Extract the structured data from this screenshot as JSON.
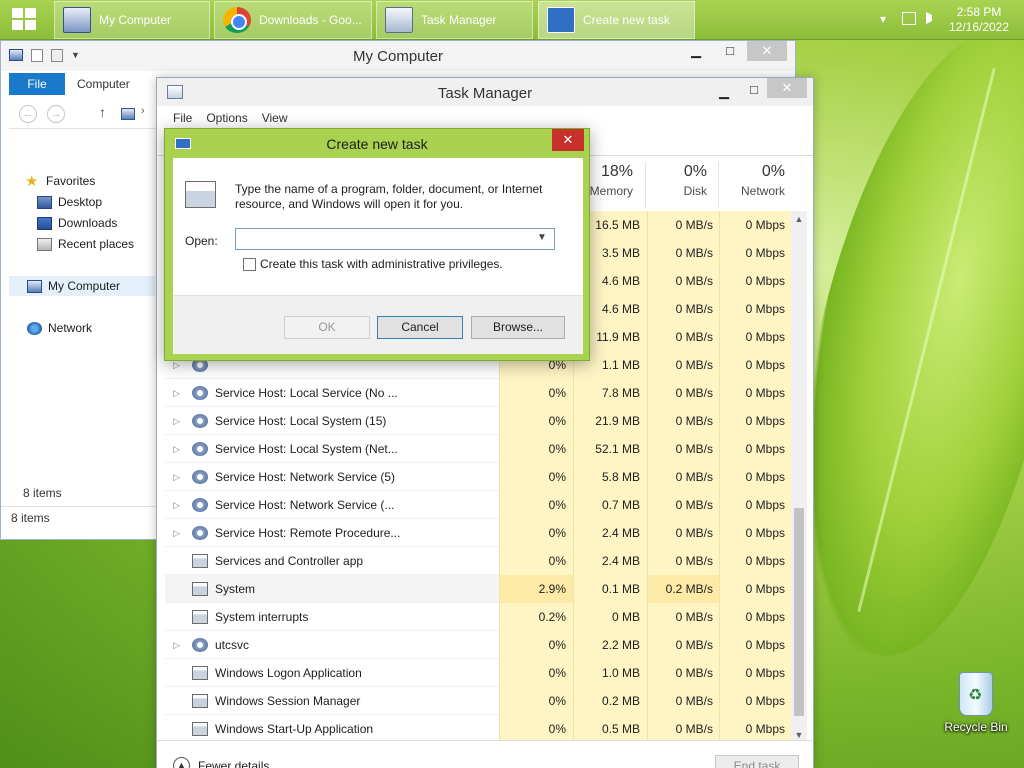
{
  "taskbar": {
    "items": [
      {
        "label": "My Computer",
        "icon": "computer-icon",
        "active": false
      },
      {
        "label": "Downloads - Goo...",
        "icon": "chrome-icon",
        "active": false
      },
      {
        "label": "Task Manager",
        "icon": "task-manager-icon",
        "active": false
      },
      {
        "label": "Create new task",
        "icon": "run-dialog-icon",
        "active": true
      }
    ],
    "tray": {
      "chevron": "▾",
      "network": "network-icon",
      "volume": "volume-icon"
    },
    "clock": {
      "time": "2:58 PM",
      "date": "12/16/2022"
    }
  },
  "my_computer": {
    "title": "My Computer",
    "ribbon": {
      "file_tab": "File",
      "computer_tab": "Computer"
    },
    "nav": [
      {
        "label": "Favorites",
        "icon": "star-icon"
      },
      {
        "label": "Desktop",
        "icon": "desktop-icon"
      },
      {
        "label": "Downloads",
        "icon": "downloads-icon"
      },
      {
        "label": "Recent places",
        "icon": "recent-places-icon"
      },
      {
        "label": "My Computer",
        "icon": "computer-icon"
      },
      {
        "label": "Network",
        "icon": "network-icon"
      }
    ],
    "items_count_inner": "8 items",
    "items_count": "8 items"
  },
  "task_manager": {
    "title": "Task Manager",
    "menu": [
      "File",
      "Options",
      "View"
    ],
    "columns": {
      "cpu": {
        "pct": "",
        "label": ""
      },
      "memory": {
        "pct": "18%",
        "label": "Memory"
      },
      "disk": {
        "pct": "0%",
        "label": "Disk"
      },
      "network": {
        "pct": "0%",
        "label": "Network"
      }
    },
    "rows": [
      {
        "name": "",
        "cpu": "",
        "mem": "16.5 MB",
        "disk": "0 MB/s",
        "net": "0 Mbps",
        "expand": false,
        "icon": "gear"
      },
      {
        "name": "",
        "cpu": "",
        "mem": "3.5 MB",
        "disk": "0 MB/s",
        "net": "0 Mbps",
        "expand": false,
        "icon": "gear"
      },
      {
        "name": "",
        "cpu": "",
        "mem": "4.6 MB",
        "disk": "0 MB/s",
        "net": "0 Mbps",
        "expand": false,
        "icon": "gear"
      },
      {
        "name": "",
        "cpu": "",
        "mem": "4.6 MB",
        "disk": "0 MB/s",
        "net": "0 Mbps",
        "expand": false,
        "icon": "gear"
      },
      {
        "name": "",
        "cpu": "",
        "mem": "11.9 MB",
        "disk": "0 MB/s",
        "net": "0 Mbps",
        "expand": false,
        "icon": "gear"
      },
      {
        "name": "",
        "cpu": "0%",
        "mem": "1.1 MB",
        "disk": "0 MB/s",
        "net": "0 Mbps",
        "expand": true,
        "icon": "gear"
      },
      {
        "name": "Service Host: Local Service (No ...",
        "cpu": "0%",
        "mem": "7.8 MB",
        "disk": "0 MB/s",
        "net": "0 Mbps",
        "expand": true,
        "icon": "gear"
      },
      {
        "name": "Service Host: Local System (15)",
        "cpu": "0%",
        "mem": "21.9 MB",
        "disk": "0 MB/s",
        "net": "0 Mbps",
        "expand": true,
        "icon": "gear"
      },
      {
        "name": "Service Host: Local System (Net...",
        "cpu": "0%",
        "mem": "52.1 MB",
        "disk": "0 MB/s",
        "net": "0 Mbps",
        "expand": true,
        "icon": "gear"
      },
      {
        "name": "Service Host: Network Service (5)",
        "cpu": "0%",
        "mem": "5.8 MB",
        "disk": "0 MB/s",
        "net": "0 Mbps",
        "expand": true,
        "icon": "gear"
      },
      {
        "name": "Service Host: Network Service (...",
        "cpu": "0%",
        "mem": "0.7 MB",
        "disk": "0 MB/s",
        "net": "0 Mbps",
        "expand": true,
        "icon": "gear"
      },
      {
        "name": "Service Host: Remote Procedure...",
        "cpu": "0%",
        "mem": "2.4 MB",
        "disk": "0 MB/s",
        "net": "0 Mbps",
        "expand": true,
        "icon": "gear"
      },
      {
        "name": "Services and Controller app",
        "cpu": "0%",
        "mem": "2.4 MB",
        "disk": "0 MB/s",
        "net": "0 Mbps",
        "expand": false,
        "icon": "app"
      },
      {
        "name": "System",
        "cpu": "2.9%",
        "mem": "0.1 MB",
        "disk": "0.2 MB/s",
        "net": "0 Mbps",
        "expand": false,
        "icon": "app",
        "highlight": true
      },
      {
        "name": "System interrupts",
        "cpu": "0.2%",
        "mem": "0 MB",
        "disk": "0 MB/s",
        "net": "0 Mbps",
        "expand": false,
        "icon": "app"
      },
      {
        "name": "utcsvc",
        "cpu": "0%",
        "mem": "2.2 MB",
        "disk": "0 MB/s",
        "net": "0 Mbps",
        "expand": true,
        "icon": "gear"
      },
      {
        "name": "Windows Logon Application",
        "cpu": "0%",
        "mem": "1.0 MB",
        "disk": "0 MB/s",
        "net": "0 Mbps",
        "expand": false,
        "icon": "app"
      },
      {
        "name": "Windows Session Manager",
        "cpu": "0%",
        "mem": "0.2 MB",
        "disk": "0 MB/s",
        "net": "0 Mbps",
        "expand": false,
        "icon": "app"
      },
      {
        "name": "Windows Start-Up Application",
        "cpu": "0%",
        "mem": "0.5 MB",
        "disk": "0 MB/s",
        "net": "0 Mbps",
        "expand": false,
        "icon": "app"
      }
    ],
    "fewer_details": "Fewer details",
    "end_task": "End task"
  },
  "dialog": {
    "title": "Create new task",
    "message": "Type the name of a program, folder, document, or Internet resource, and Windows will open it for you.",
    "open_label": "Open:",
    "open_value": "",
    "admin_checkbox": "Create this task with administrative privileges.",
    "ok": "OK",
    "cancel": "Cancel",
    "browse": "Browse..."
  },
  "desktop": {
    "recycle_bin": "Recycle Bin"
  },
  "glyphs": {
    "minimize": "▁",
    "maximize": "□",
    "close": "✕",
    "expand": "▷",
    "chevron_up": "▲",
    "chevron_down": "▼",
    "dropdown": "▼",
    "back": "←",
    "forward": "→",
    "up": "↑",
    "nav_chevron": "›"
  }
}
